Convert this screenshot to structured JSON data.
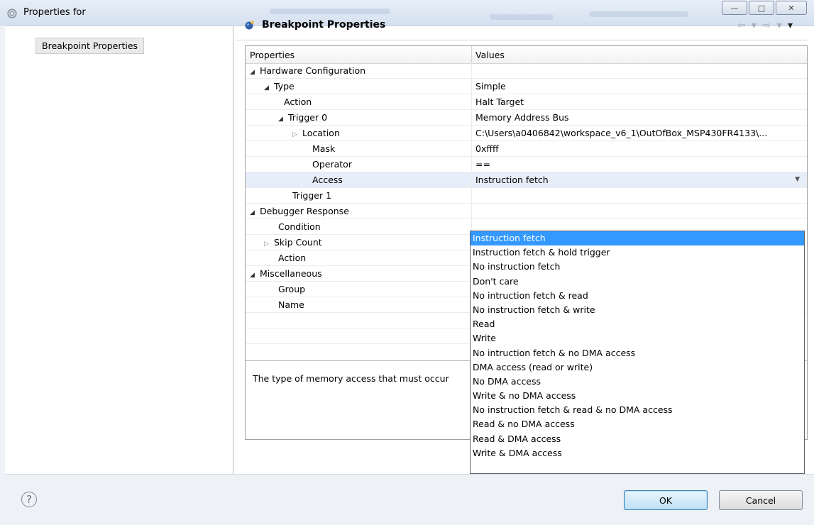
{
  "window": {
    "title": "Properties for",
    "controls": {
      "minimize": "—",
      "maximize": "□",
      "close": "✕"
    }
  },
  "nav": {
    "items": [
      {
        "label": "Breakpoint Properties"
      }
    ]
  },
  "page": {
    "title": "Breakpoint Properties",
    "nav_arrows": {
      "back": "⇦ ▾",
      "forward": "⇨ ▾",
      "menu": "▾"
    }
  },
  "table": {
    "headers": {
      "properties": "Properties",
      "values": "Values"
    },
    "rows": [
      {
        "label": "Hardware Configuration",
        "value": ""
      },
      {
        "label": "Type",
        "value": "Simple"
      },
      {
        "label": "Action",
        "value": "Halt Target"
      },
      {
        "label": "Trigger 0",
        "value": "Memory Address Bus"
      },
      {
        "label": "Location",
        "value": "C:\\Users\\a0406842\\workspace_v6_1\\OutOfBox_MSP430FR4133\\..."
      },
      {
        "label": "Mask",
        "value": "0xffff"
      },
      {
        "label": "Operator",
        "value": "=="
      },
      {
        "label": "Access",
        "value": "Instruction fetch"
      },
      {
        "label": "Trigger 1",
        "value": ""
      },
      {
        "label": "Debugger Response",
        "value": ""
      },
      {
        "label": "Condition",
        "value": ""
      },
      {
        "label": "Skip Count",
        "value": ""
      },
      {
        "label": "Action",
        "value": ""
      },
      {
        "label": "Miscellaneous",
        "value": ""
      },
      {
        "label": "Group",
        "value": ""
      },
      {
        "label": "Name",
        "value": ""
      }
    ],
    "description": "The type of memory access that must occur"
  },
  "access_dropdown": {
    "selected": "Instruction fetch",
    "options": [
      "Instruction fetch",
      "Instruction fetch & hold trigger",
      "No instruction fetch",
      "Don't care",
      "No intruction fetch & read",
      "No instruction fetch & write",
      "Read",
      "Write",
      "No intruction fetch & no DMA access",
      "DMA access (read or write)",
      "No DMA access",
      "Write & no DMA access",
      "No instruction fetch & read & no DMA access",
      "Read & no DMA access",
      "Read & DMA access",
      "Write & DMA access"
    ]
  },
  "footer": {
    "help": "?",
    "ok": "OK",
    "cancel": "Cancel"
  }
}
